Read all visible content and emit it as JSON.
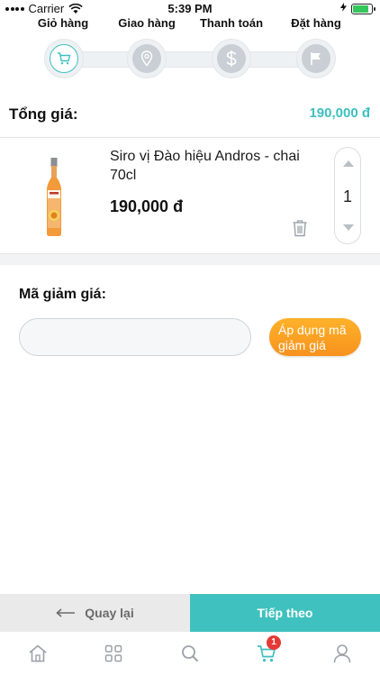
{
  "status": {
    "carrier": "Carrier",
    "time": "5:39 PM"
  },
  "steps": [
    {
      "label": "Giỏ hàng",
      "icon": "cart-icon",
      "active": true
    },
    {
      "label": "Giao hàng",
      "icon": "location-pin-icon",
      "active": false
    },
    {
      "label": "Thanh toán",
      "icon": "dollar-icon",
      "active": false
    },
    {
      "label": "Đặt hàng",
      "icon": "flag-icon",
      "active": false
    }
  ],
  "total": {
    "label": "Tổng giá:",
    "value": "190,000 đ"
  },
  "item": {
    "name": "Siro vị Đào hiệu Andros - chai 70cl",
    "price": "190,000 đ",
    "quantity": "1"
  },
  "coupon": {
    "label": "Mã giảm giá:",
    "placeholder": "",
    "button": "Áp dụng mã giảm giá"
  },
  "actions": {
    "back": "Quay lại",
    "next": "Tiếp theo"
  },
  "tabbar": {
    "items": [
      "home-icon",
      "grid-icon",
      "search-icon",
      "cart-icon",
      "user-icon"
    ],
    "cart_badge": "1"
  },
  "colors": {
    "accent": "#3ebfbf",
    "orange": "#f7921e",
    "badge": "#e53935"
  }
}
